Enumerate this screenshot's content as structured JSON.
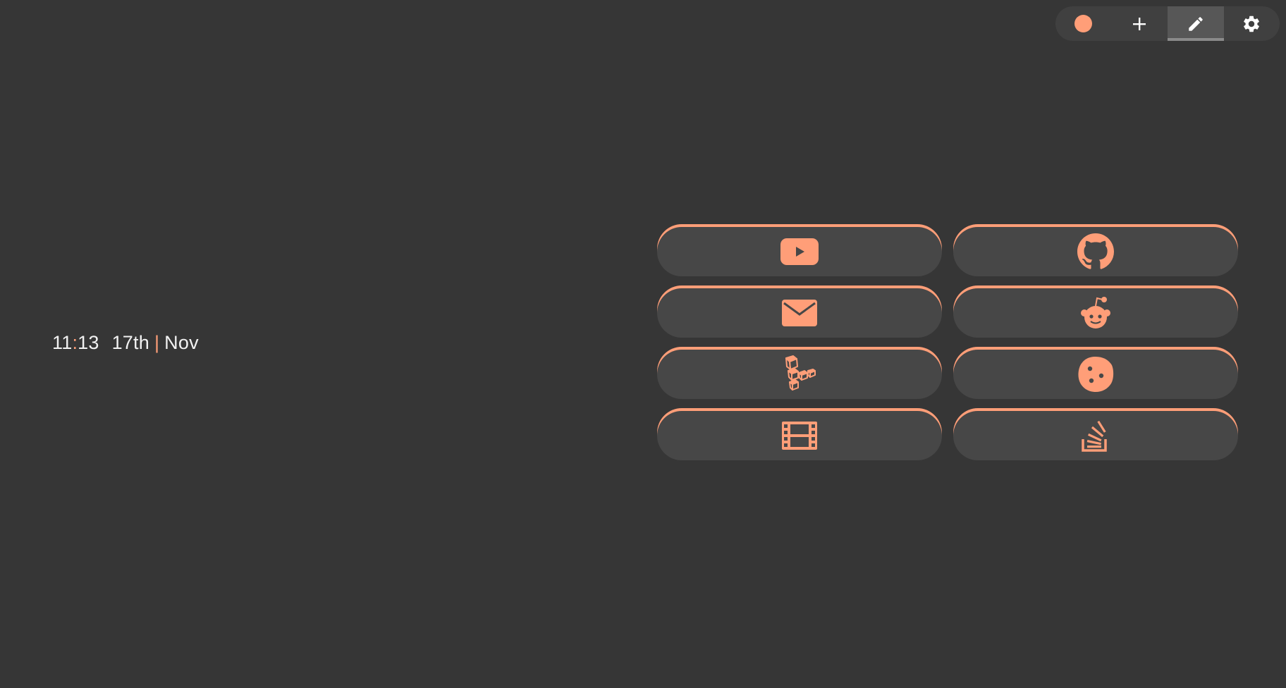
{
  "theme": {
    "accent": "#ff9e78",
    "background": "#363636",
    "card": "#474747",
    "text": "#f2f2f2"
  },
  "toolbar": {
    "buttons": [
      {
        "icon": "theme-dot-icon"
      },
      {
        "icon": "plus-icon"
      },
      {
        "icon": "pencil-icon",
        "active": true
      },
      {
        "icon": "gear-icon"
      }
    ]
  },
  "clock": {
    "hours": "11",
    "separator": ":",
    "minutes": "13",
    "day": "17th",
    "divider": "|",
    "month": "Nov"
  },
  "bookmarks": [
    {
      "icon": "youtube-icon"
    },
    {
      "icon": "github-icon"
    },
    {
      "icon": "mail-icon"
    },
    {
      "icon": "reddit-icon"
    },
    {
      "icon": "linode-icon"
    },
    {
      "icon": "cookie-icon"
    },
    {
      "icon": "film-icon"
    },
    {
      "icon": "stackoverflow-icon"
    }
  ]
}
